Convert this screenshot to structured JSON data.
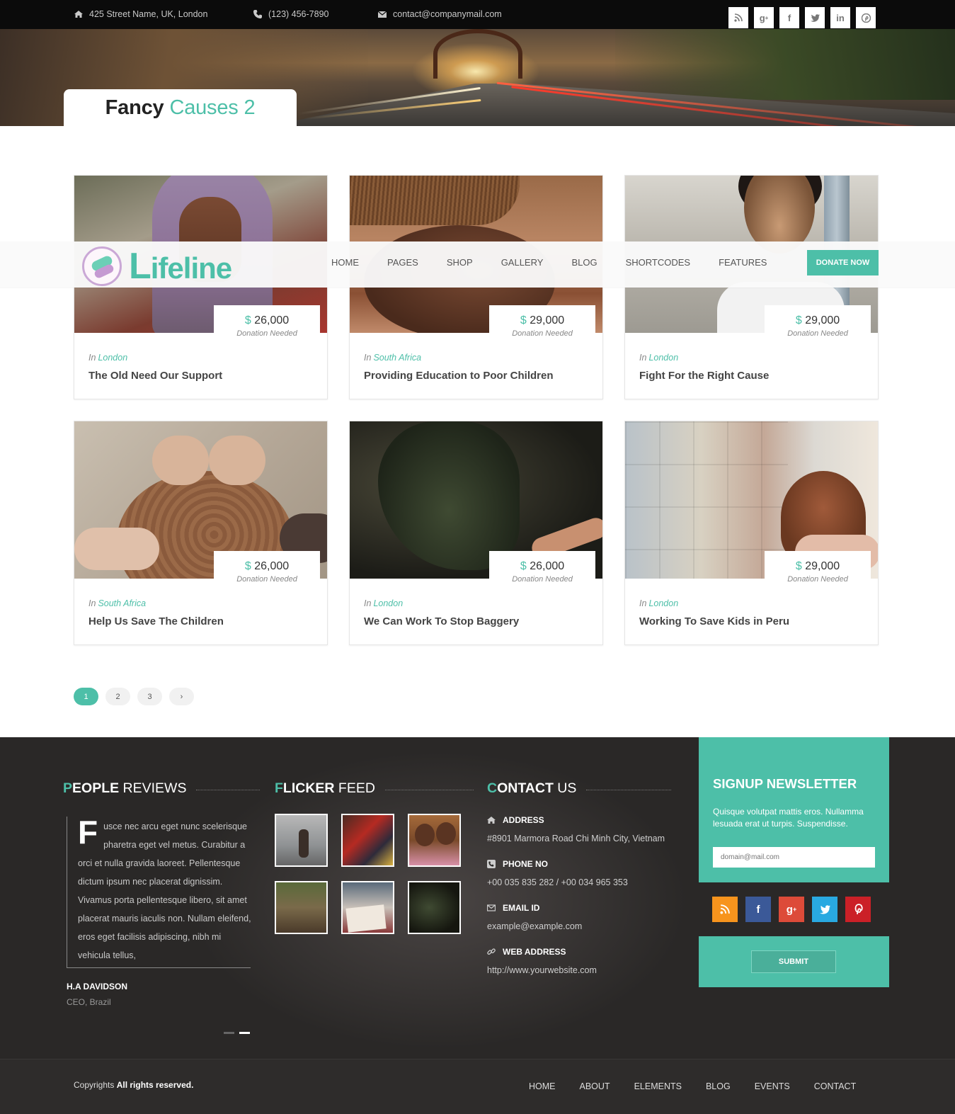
{
  "topbar": {
    "address": "425 Street Name, UK, London",
    "phone": "(123) 456-7890",
    "email": "contact@companymail.com",
    "social_icons": [
      "rss-icon",
      "google-plus-icon",
      "facebook-icon",
      "twitter-icon",
      "linkedin-icon",
      "pinterest-icon"
    ]
  },
  "page_title": {
    "main": "Fancy",
    "accent": "Causes 2"
  },
  "brand": {
    "logo_text": "ifeline",
    "logo_initial": "L"
  },
  "nav": {
    "items": [
      "HOME",
      "PAGES",
      "SHOP",
      "GALLERY",
      "BLOG",
      "SHORTCODES",
      "FEATURES"
    ],
    "donate_label": "DONATE NOW"
  },
  "causes": [
    {
      "amount": "26,000",
      "needed": "Donation Needed",
      "in": "In",
      "location": "London",
      "title": "The Old Need Our Support"
    },
    {
      "amount": "29,000",
      "needed": "Donation Needed",
      "in": "In",
      "location": "South Africa",
      "title": "Providing Education to Poor Children"
    },
    {
      "amount": "29,000",
      "needed": "Donation Needed",
      "in": "In",
      "location": "London",
      "title": "Fight For the Right Cause"
    },
    {
      "amount": "26,000",
      "needed": "Donation Needed",
      "in": "In",
      "location": "South Africa",
      "title": "Help Us Save The Children"
    },
    {
      "amount": "26,000",
      "needed": "Donation Needed",
      "in": "In",
      "location": "London",
      "title": "We Can Work To Stop Baggery"
    },
    {
      "amount": "29,000",
      "needed": "Donation Needed",
      "in": "In",
      "location": "London",
      "title": "Working To Save Kids in Peru"
    }
  ],
  "currency": "$",
  "pagination": {
    "pages": [
      "1",
      "2",
      "3"
    ],
    "next": "›",
    "current": "1"
  },
  "reviews": {
    "title_first": "P",
    "title_bold": "EOPLE",
    "title_rest": " REVIEWS",
    "drop_cap": "F",
    "text": "usce nec arcu eget nunc scelerisque pharetra eget vel metus. Curabitur a orci et nulla gravida laoreet. Pellentesque dictum ipsum nec placerat dignissim. Vivamus porta pellentesque libero, sit amet placerat mauris iaculis non. Nullam eleifend, eros eget facilisis adipiscing, nibh mi vehicula tellus,",
    "name": "H.A DAVIDSON",
    "role": "CEO, Brazil"
  },
  "flickr": {
    "title_first": "F",
    "title_bold": "LICKER",
    "title_rest": " FEED"
  },
  "contact": {
    "title_first": "C",
    "title_bold": "ONTACT",
    "title_rest": " US",
    "address_label": "ADDRESS",
    "address": "#8901 Marmora Road Chi Minh City, Vietnam",
    "phone_label": "PHONE NO",
    "phone": "+00 035 835 282 / +00 034 965 353",
    "email_label": "EMAIL ID",
    "email": "example@example.com",
    "web_label": "WEB ADDRESS",
    "web": "http://www.yourwebsite.com"
  },
  "newsletter": {
    "title": "SIGNUP NEWSLETTER",
    "text": "Quisque volutpat mattis eros. Nullamma lesuada erat ut turpis. Suspendisse.",
    "placeholder": "domain@mail.com",
    "submit_label": "SUBMIT",
    "social_colors": {
      "rss": "#f7941d",
      "facebook": "#3b5998",
      "google": "#dd4b39",
      "twitter": "#29a9e1",
      "pinterest": "#cb2027"
    }
  },
  "footer_bar": {
    "copy_pre": "Copyrights",
    "copy_bold": "All rights reserved.",
    "links": [
      "HOME",
      "ABOUT",
      "ELEMENTS",
      "BLOG",
      "EVENTS",
      "CONTACT"
    ]
  },
  "colors": {
    "accent": "#4dbfa8"
  }
}
